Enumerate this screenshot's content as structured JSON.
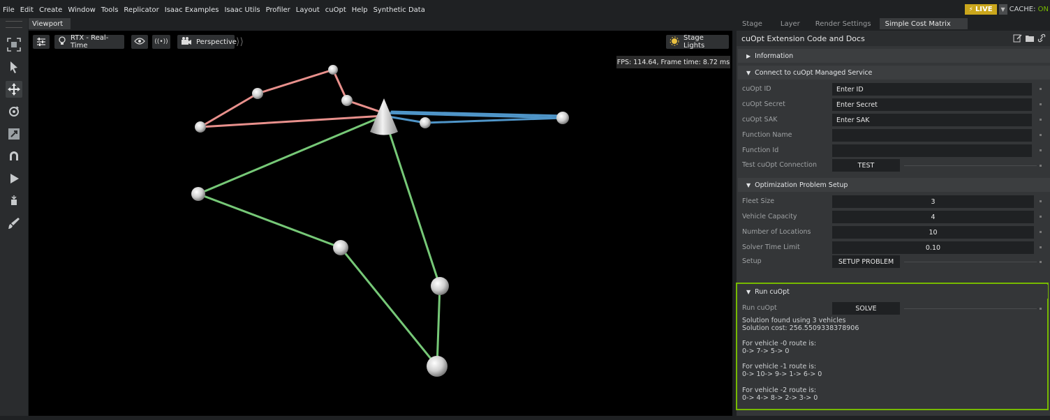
{
  "menubar": {
    "items": [
      "File",
      "Edit",
      "Create",
      "Window",
      "Tools",
      "Replicator",
      "Isaac Examples",
      "Isaac Utils",
      "Profiler",
      "Layout",
      "cuOpt",
      "Help",
      "Synthetic Data"
    ],
    "live_label": "LIVE",
    "cache_label": "CACHE:",
    "cache_value": "ON"
  },
  "viewport": {
    "tab_label": "Viewport",
    "render_mode": "RTX - Real-Time",
    "camera": "Perspective",
    "lights": "Stage Lights",
    "fps_text": "FPS: 114.64, Frame time: 8.72 ms"
  },
  "left_toolbar": {
    "icons": [
      "frame-icon",
      "select-icon",
      "move-icon",
      "rotate-icon",
      "scale-icon",
      "snap-icon",
      "play-icon",
      "physics-icon",
      "paint-icon"
    ]
  },
  "scene": {
    "routes": [
      {
        "vehicle": 0,
        "color": "#76c877"
      },
      {
        "vehicle": 1,
        "color": "#e8908c"
      },
      {
        "vehicle": 2,
        "color": "#4f95c8"
      }
    ]
  },
  "right_panel": {
    "tabs": [
      {
        "label": "Stage",
        "active": false
      },
      {
        "label": "Layer",
        "active": false
      },
      {
        "label": "Render Settings",
        "active": false
      },
      {
        "label": "Simple Cost Matrix",
        "active": true
      }
    ],
    "title": "cuOpt Extension Code and Docs",
    "information": {
      "header": "Information"
    },
    "connect": {
      "header": "Connect to cuOpt Managed Service",
      "rows": [
        {
          "label": "cuOpt ID",
          "value": "Enter ID"
        },
        {
          "label": "cuOpt Secret",
          "value": "Enter Secret"
        },
        {
          "label": "cuOpt SAK",
          "value": "Enter SAK"
        },
        {
          "label": "Function Name",
          "value": ""
        },
        {
          "label": "Function Id",
          "value": ""
        }
      ],
      "test_label": "Test cuOpt Connection",
      "test_button": "TEST"
    },
    "setup": {
      "header": "Optimization Problem Setup",
      "rows": [
        {
          "label": "Fleet Size",
          "value": "3"
        },
        {
          "label": "Vehicle Capacity",
          "value": "4"
        },
        {
          "label": "Number of Locations",
          "value": "10"
        },
        {
          "label": "Solver Time Limit",
          "value": "0.10"
        }
      ],
      "setup_label": "Setup",
      "setup_button": "SETUP PROBLEM"
    },
    "run": {
      "header": "Run cuOpt",
      "run_label": "Run cuOpt",
      "solve_button": "SOLVE",
      "solution_line1": "Solution found using 3 vehicles",
      "solution_line2": "Solution cost: 256.5509338378906",
      "routes": [
        {
          "title": "For vehicle -0 route is:",
          "route": "0-> 7-> 5-> 0"
        },
        {
          "title": "For vehicle -1 route is:",
          "route": "0-> 10-> 9-> 1-> 6-> 0"
        },
        {
          "title": "For vehicle -2 route is:",
          "route": "0-> 4-> 8-> 2-> 3-> 0"
        }
      ]
    }
  }
}
